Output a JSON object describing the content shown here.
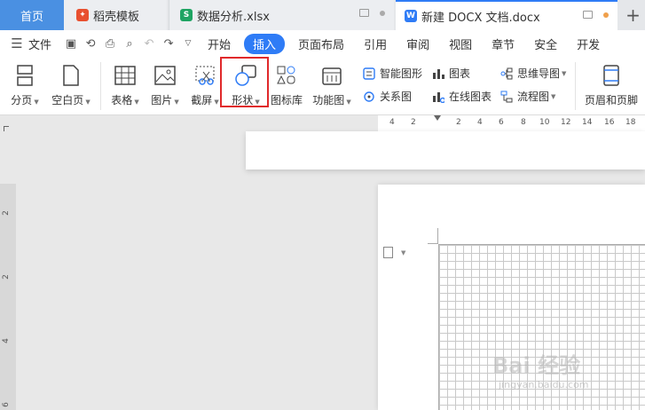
{
  "tabs": {
    "home": "首页",
    "template": "稻壳模板",
    "xlsx": "数据分析.xlsx",
    "docx": "新建 DOCX 文档.docx",
    "add": "+"
  },
  "menu": {
    "file": "文件",
    "items": [
      "开始",
      "插入",
      "页面布局",
      "引用",
      "审阅",
      "视图",
      "章节",
      "安全",
      "开发"
    ],
    "active": "插入"
  },
  "ribbon": {
    "page_break": "分页",
    "blank_page": "空白页",
    "table": "表格",
    "picture": "图片",
    "screenshot": "截屏",
    "shape": "形状",
    "icon_lib": "图标库",
    "function_chart": "功能图",
    "smart_shape": "智能图形",
    "relation_chart": "关系图",
    "chart": "图表",
    "online_chart": "在线图表",
    "mind_map": "思维导图",
    "flow_chart": "流程图",
    "header_footer": "页眉和页脚"
  },
  "ruler_top": [
    "4",
    "2",
    "2",
    "4",
    "6",
    "8",
    "10",
    "12",
    "14",
    "16",
    "18"
  ],
  "ruler_left": [
    "2",
    "2",
    "4",
    "6"
  ],
  "watermark": {
    "text": "Bai 经验",
    "url": "jingyan.baidu.com"
  },
  "colors": {
    "accent": "#2f7cf6",
    "highlight": "#e0292b",
    "home_tab": "#4a90e2"
  }
}
